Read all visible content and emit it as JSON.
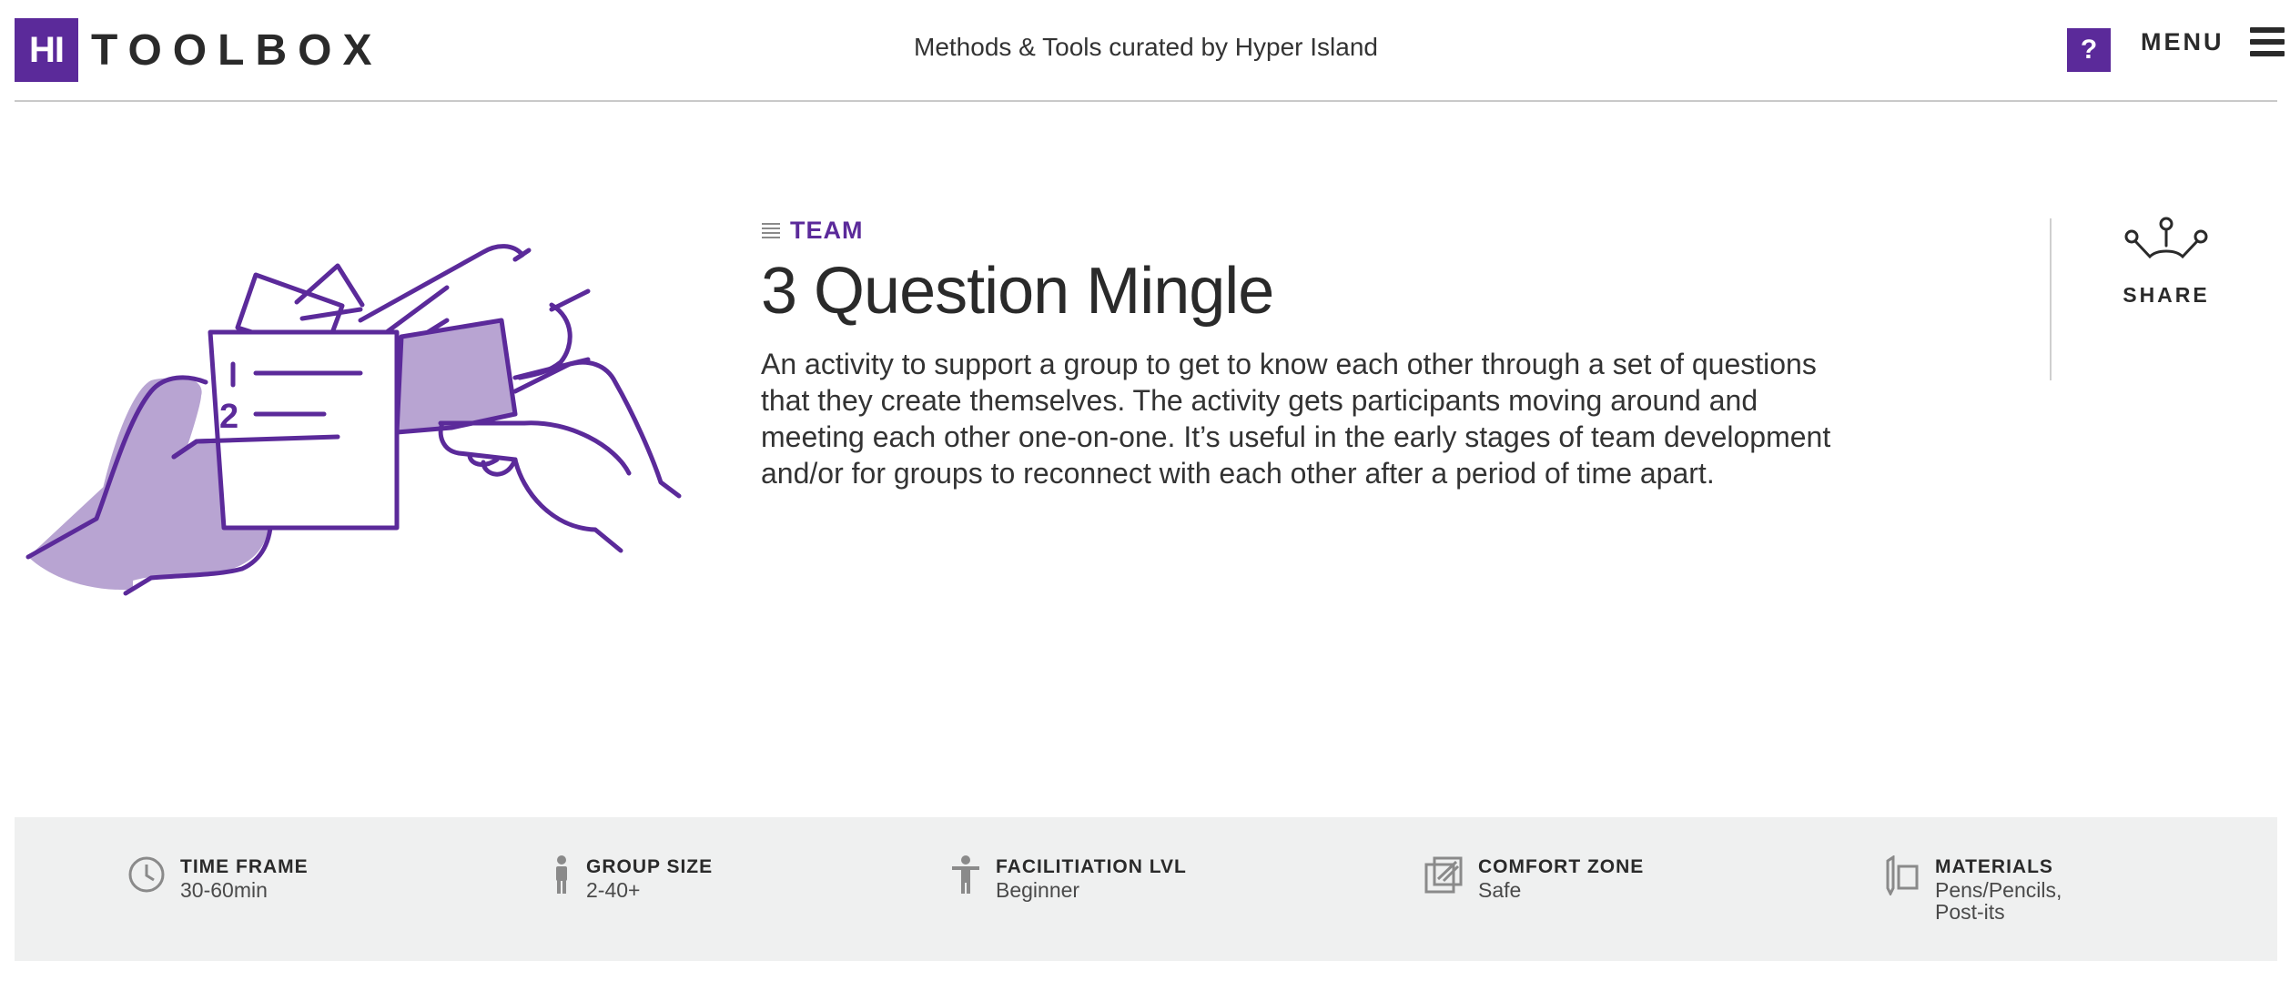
{
  "header": {
    "logo_mark": "HI",
    "logo_word": "TOOLBOX",
    "tagline": "Methods & Tools curated by Hyper Island",
    "help_label": "?",
    "menu_label": "MENU"
  },
  "method": {
    "category": "TEAM",
    "title": "3 Question Mingle",
    "description": "An activity to support a group to get to know each other through a set of questions that they create themselves. The activity gets participants moving around and meeting each other one-on-one. It’s useful in the early stages of team development and/or for groups to reconnect with each other after a period of time apart.",
    "card_numbers": [
      "1",
      "2"
    ]
  },
  "share": {
    "label": "SHARE"
  },
  "info": [
    {
      "label": "TIME FRAME",
      "value": "30-60min",
      "icon": "clock-icon"
    },
    {
      "label": "GROUP SIZE",
      "value": "2-40+",
      "icon": "person-icon"
    },
    {
      "label": "FACILITIATION LVL",
      "value": "Beginner",
      "icon": "facilitator-icon"
    },
    {
      "label": "COMFORT ZONE",
      "value": "Safe",
      "icon": "comfort-zone-icon"
    },
    {
      "label": "MATERIALS",
      "value": "Pens/Pencils, Post-its",
      "icon": "pencil-icon"
    }
  ],
  "colors": {
    "brand": "#5b2a9a",
    "illustration_fill": "#b8a4d2",
    "infobar_bg": "#eff0f0"
  }
}
